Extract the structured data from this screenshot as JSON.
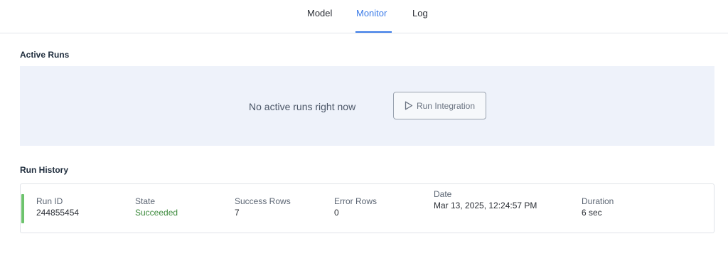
{
  "nav": {
    "tabs": [
      {
        "label": "Model",
        "active": false
      },
      {
        "label": "Monitor",
        "active": true
      },
      {
        "label": "Log",
        "active": false
      }
    ]
  },
  "active_runs": {
    "title": "Active Runs",
    "empty_message": "No active runs right now",
    "run_button": {
      "label": "Run Integration",
      "icon": "play-outline-icon"
    }
  },
  "run_history": {
    "title": "Run History",
    "rows": [
      {
        "status_color": "#6dc36d",
        "columns": [
          {
            "label": "Run ID",
            "value": "244855454"
          },
          {
            "label": "State",
            "value": "Succeeded"
          },
          {
            "label": "Success Rows",
            "value": "7"
          },
          {
            "label": "Error Rows",
            "value": "0"
          },
          {
            "label": "Date",
            "value": "Mar 13, 2025, 12:24:57 PM"
          },
          {
            "label": "Duration",
            "value": "6 sec"
          }
        ]
      }
    ]
  },
  "colors": {
    "accent": "#3b7be8",
    "success": "#3c8a3c",
    "panel_bg": "#eef2fa"
  }
}
